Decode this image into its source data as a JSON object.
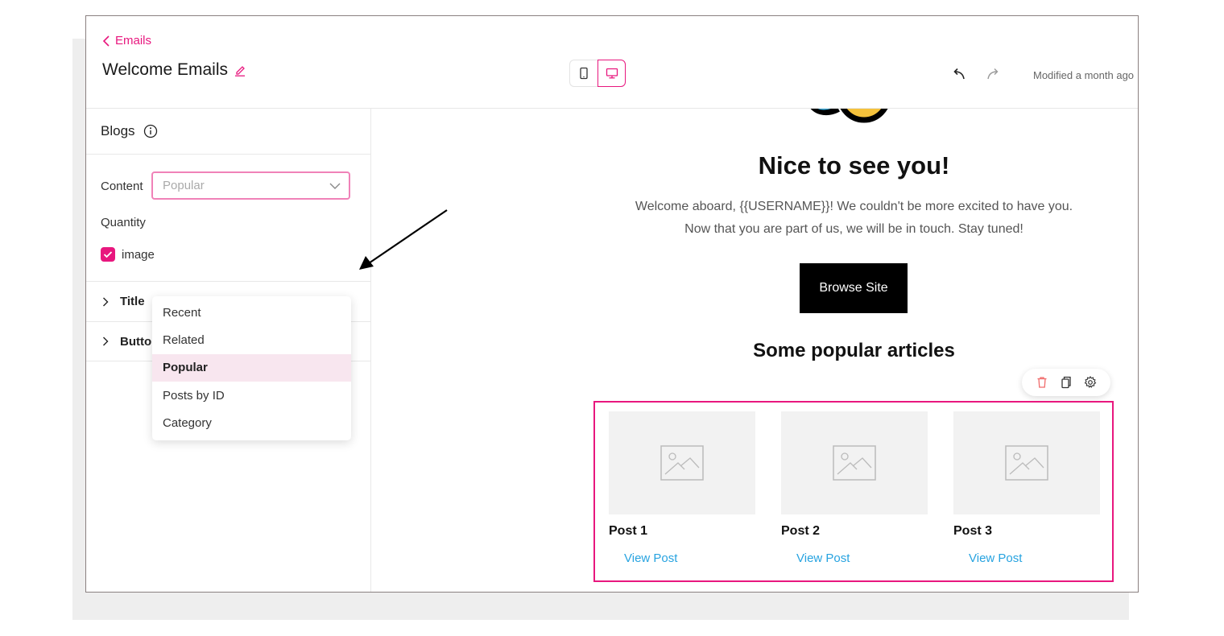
{
  "header": {
    "back_label": "Emails",
    "title": "Welcome Emails",
    "modified": "Modified a month ago",
    "device_modes": [
      "mobile",
      "desktop"
    ],
    "active_device": "desktop"
  },
  "sidebar": {
    "heading": "Blogs",
    "content_label": "Content",
    "content_value": "Popular",
    "quantity_label": "Quantity",
    "image_checkbox_label": "image",
    "image_checked": true,
    "sections": [
      {
        "label": "Title"
      },
      {
        "label": "Butto"
      }
    ],
    "dropdown_options": [
      {
        "label": "Recent",
        "selected": false
      },
      {
        "label": "Related",
        "selected": false
      },
      {
        "label": "Popular",
        "selected": true
      },
      {
        "label": "Posts by ID",
        "selected": false
      },
      {
        "label": "Category",
        "selected": false
      }
    ]
  },
  "email": {
    "hero_title": "Nice to see you!",
    "hero_line1": "Welcome aboard, {{USERNAME}}! We couldn't be more excited to have you.",
    "hero_line2": "Now that you are part of us, we will be in touch. Stay tuned!",
    "cta_label": "Browse Site",
    "popular_title": "Some popular articles",
    "posts": [
      {
        "title": "Post 1",
        "link": "View Post"
      },
      {
        "title": "Post 2",
        "link": "View Post"
      },
      {
        "title": "Post 3",
        "link": "View Post"
      }
    ]
  },
  "colors": {
    "accent": "#e8177e",
    "link": "#27a3e0",
    "selected_bg": "#f8e6ef",
    "delete": "#f06b6b"
  }
}
